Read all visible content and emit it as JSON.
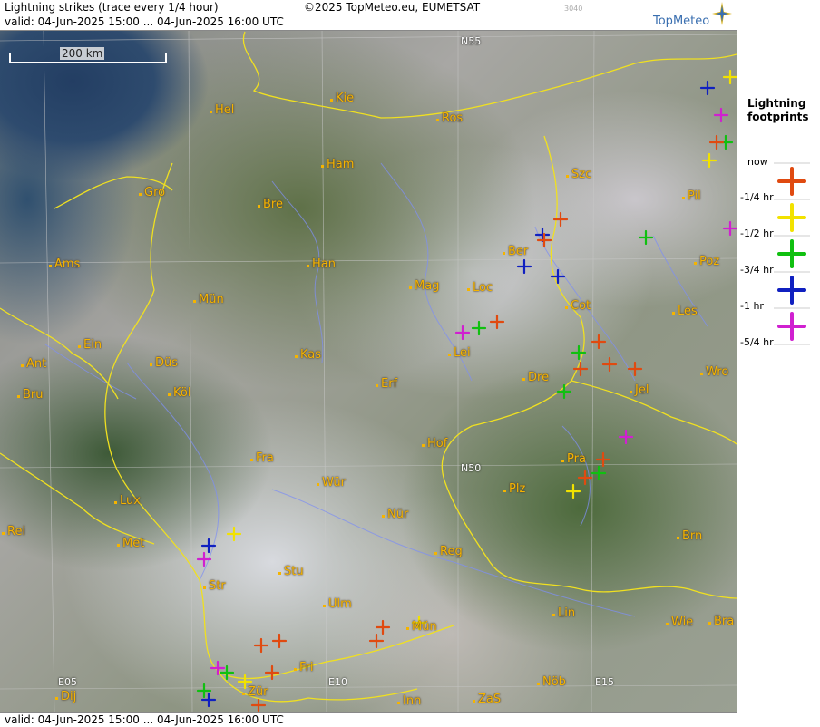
{
  "header": {
    "title": "Lightning strikes (trace every 1/4 hour)",
    "valid": "valid:  04-Jun-2025 15:00 ... 04-Jun-2025 16:00 UTC",
    "copyright": "©2025 TopMeteo.eu, EUMETSAT",
    "code": "3040",
    "logo": "TopMeteo"
  },
  "footer": {
    "valid": "valid:  04-Jun-2025 15:00 ... 04-Jun-2025 16:00 UTC"
  },
  "scale": {
    "label": "200 km"
  },
  "legend": {
    "title_line1": "Lightning",
    "title_line2": "footprints",
    "items": [
      {
        "label": "now",
        "color": "#e04a10"
      },
      {
        "label": "-1/4 hr",
        "color": "#f2e200"
      },
      {
        "label": "-1/2 hr",
        "color": "#10c010"
      },
      {
        "label": "-3/4 hr",
        "color": "#1020c0"
      },
      {
        "label": "-1 hr",
        "color": "#d020d0"
      },
      {
        "label": "-5/4 hr",
        "color": ""
      }
    ]
  },
  "grid_labels": {
    "n55": "N55",
    "n50": "N50",
    "e05": "E05",
    "e10": "E10",
    "e15": "E15"
  },
  "cities": [
    {
      "name": "Kie"
    },
    {
      "name": "Hel"
    },
    {
      "name": "Ros"
    },
    {
      "name": "Ham"
    },
    {
      "name": "Szc"
    },
    {
      "name": "Gro"
    },
    {
      "name": "Bre"
    },
    {
      "name": "Pil"
    },
    {
      "name": "Ber"
    },
    {
      "name": "Ams"
    },
    {
      "name": "Han"
    },
    {
      "name": "Poz"
    },
    {
      "name": "Mag"
    },
    {
      "name": "Loc"
    },
    {
      "name": "Mün"
    },
    {
      "name": "Cot"
    },
    {
      "name": "Les"
    },
    {
      "name": "Ein"
    },
    {
      "name": "Kas"
    },
    {
      "name": "Lei"
    },
    {
      "name": "Ant"
    },
    {
      "name": "Düs"
    },
    {
      "name": "Wro"
    },
    {
      "name": "Bru"
    },
    {
      "name": "Köl"
    },
    {
      "name": "Erf"
    },
    {
      "name": "Dre"
    },
    {
      "name": "Jel"
    },
    {
      "name": "Hof"
    },
    {
      "name": "Fra"
    },
    {
      "name": "Pra"
    },
    {
      "name": "Wür"
    },
    {
      "name": "Plz"
    },
    {
      "name": "Lux"
    },
    {
      "name": "Nür"
    },
    {
      "name": "Rei"
    },
    {
      "name": "Met"
    },
    {
      "name": "Brn"
    },
    {
      "name": "Reg"
    },
    {
      "name": "Stu"
    },
    {
      "name": "Str"
    },
    {
      "name": "Ulm"
    },
    {
      "name": "Lin"
    },
    {
      "name": "Mün"
    },
    {
      "name": "Wie"
    },
    {
      "name": "Bra"
    },
    {
      "name": "Fri"
    },
    {
      "name": "Nöb"
    },
    {
      "name": "Dij"
    },
    {
      "name": "Zür"
    },
    {
      "name": "Inn"
    },
    {
      "name": "ZaS"
    }
  ]
}
